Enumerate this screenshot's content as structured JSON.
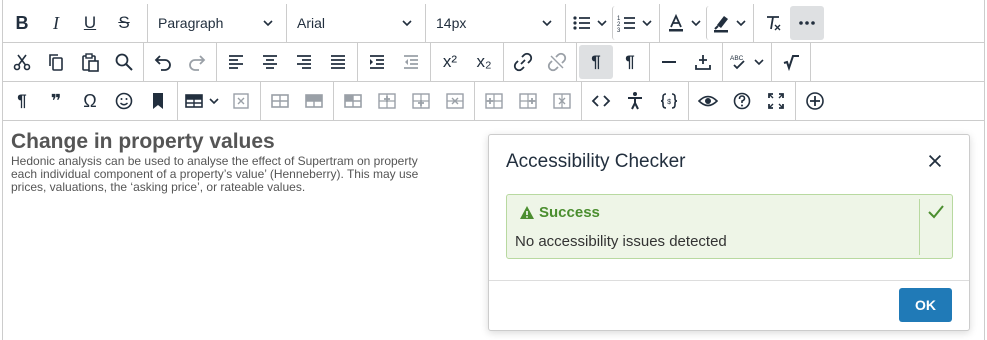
{
  "toolbar": {
    "block_format": "Paragraph",
    "font_family": "Arial",
    "font_size": "14px",
    "row1_icons": [
      "bold-icon",
      "italic-icon",
      "underline-icon",
      "strikethrough-icon"
    ],
    "icons": {
      "bold": "B",
      "italic": "I",
      "underline": "U",
      "strike": "S",
      "superscript": "x²",
      "subscript": "x₂",
      "special_char": "Ω",
      "quote": "❞",
      "pilcrow": "¶",
      "ltr": "¶",
      "rtl": "¶",
      "spellcheck_abc": "ABC",
      "emoticon": "☺"
    }
  },
  "content": {
    "heading": "Change in property values",
    "lines": [
      "Hedonic analysis can be used to analyse the effect of Supertram on property",
      "each individual component of a property’s value’ (Henneberry). This may use",
      "prices, valuations, the ‘asking price’, or rateable values."
    ]
  },
  "dialog": {
    "title": "Accessibility Checker",
    "status": "Success",
    "message": "No accessibility issues detected",
    "ok_label": "OK"
  },
  "colors": {
    "primary_button": "#207ab7",
    "success_bg": "#eef5e7",
    "success_border": "#b8d9a0",
    "success_text": "#4b8e2f",
    "active_button": "#dee0e2"
  }
}
